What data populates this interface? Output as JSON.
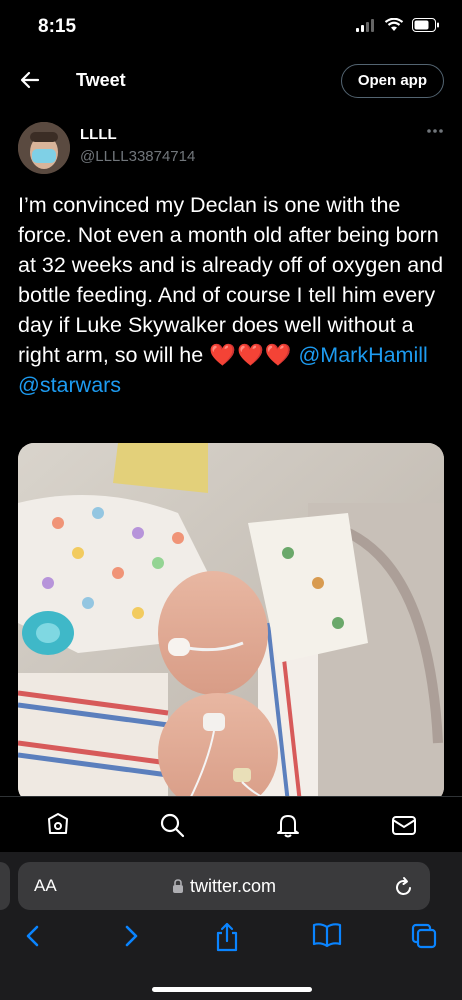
{
  "status_bar": {
    "time": "8:15"
  },
  "nav": {
    "title": "Tweet",
    "open_app_label": "Open app"
  },
  "tweet": {
    "author_name": "LLLL",
    "author_handle": "@LLLL33874714",
    "text_line1": "I’m convinced my Declan is one with the force. Not even a month old after being born at 32 weeks and is already off of oxygen and bottle feeding. And of course I tell him every day if Luke Skywalker does well without a right arm, so will he ",
    "hearts": "❤️❤️❤️",
    "mention1": "@MarkHamill",
    "mention2": "@starwars"
  },
  "browser": {
    "text_size_label": "AA",
    "url": "twitter.com"
  },
  "colors": {
    "accent": "#1d9bf0",
    "background": "#000000",
    "heart": "#e0245e"
  }
}
